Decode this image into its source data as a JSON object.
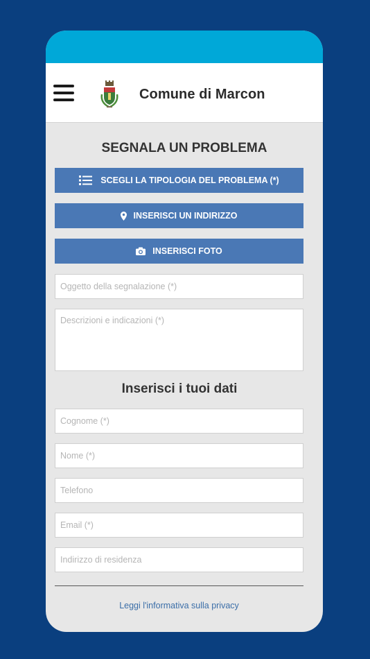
{
  "header": {
    "title": "Comune di Marcon"
  },
  "form": {
    "title": "SEGNALA UN PROBLEMA",
    "typology_button": "SCEGLI LA TIPOLOGIA DEL PROBLEMA (*)",
    "address_button": "INSERISCI UN INDIRIZZO",
    "photo_button": "INSERISCI FOTO",
    "subject_placeholder": "Oggetto della segnalazione (*)",
    "description_placeholder": "Descrizioni e indicazioni (*)"
  },
  "personal": {
    "title": "Inserisci i tuoi dati",
    "surname_placeholder": "Cognome (*)",
    "name_placeholder": "Nome (*)",
    "phone_placeholder": "Telefono",
    "email_placeholder": "Email (*)",
    "residence_placeholder": "Indirizzo di residenza"
  },
  "footer": {
    "privacy_link": "Leggi l'informativa sulla privacy"
  },
  "colors": {
    "background": "#0a3f7f",
    "status_bar": "#00a8d8",
    "button": "#4a78b5",
    "link": "#3b6ea8"
  }
}
